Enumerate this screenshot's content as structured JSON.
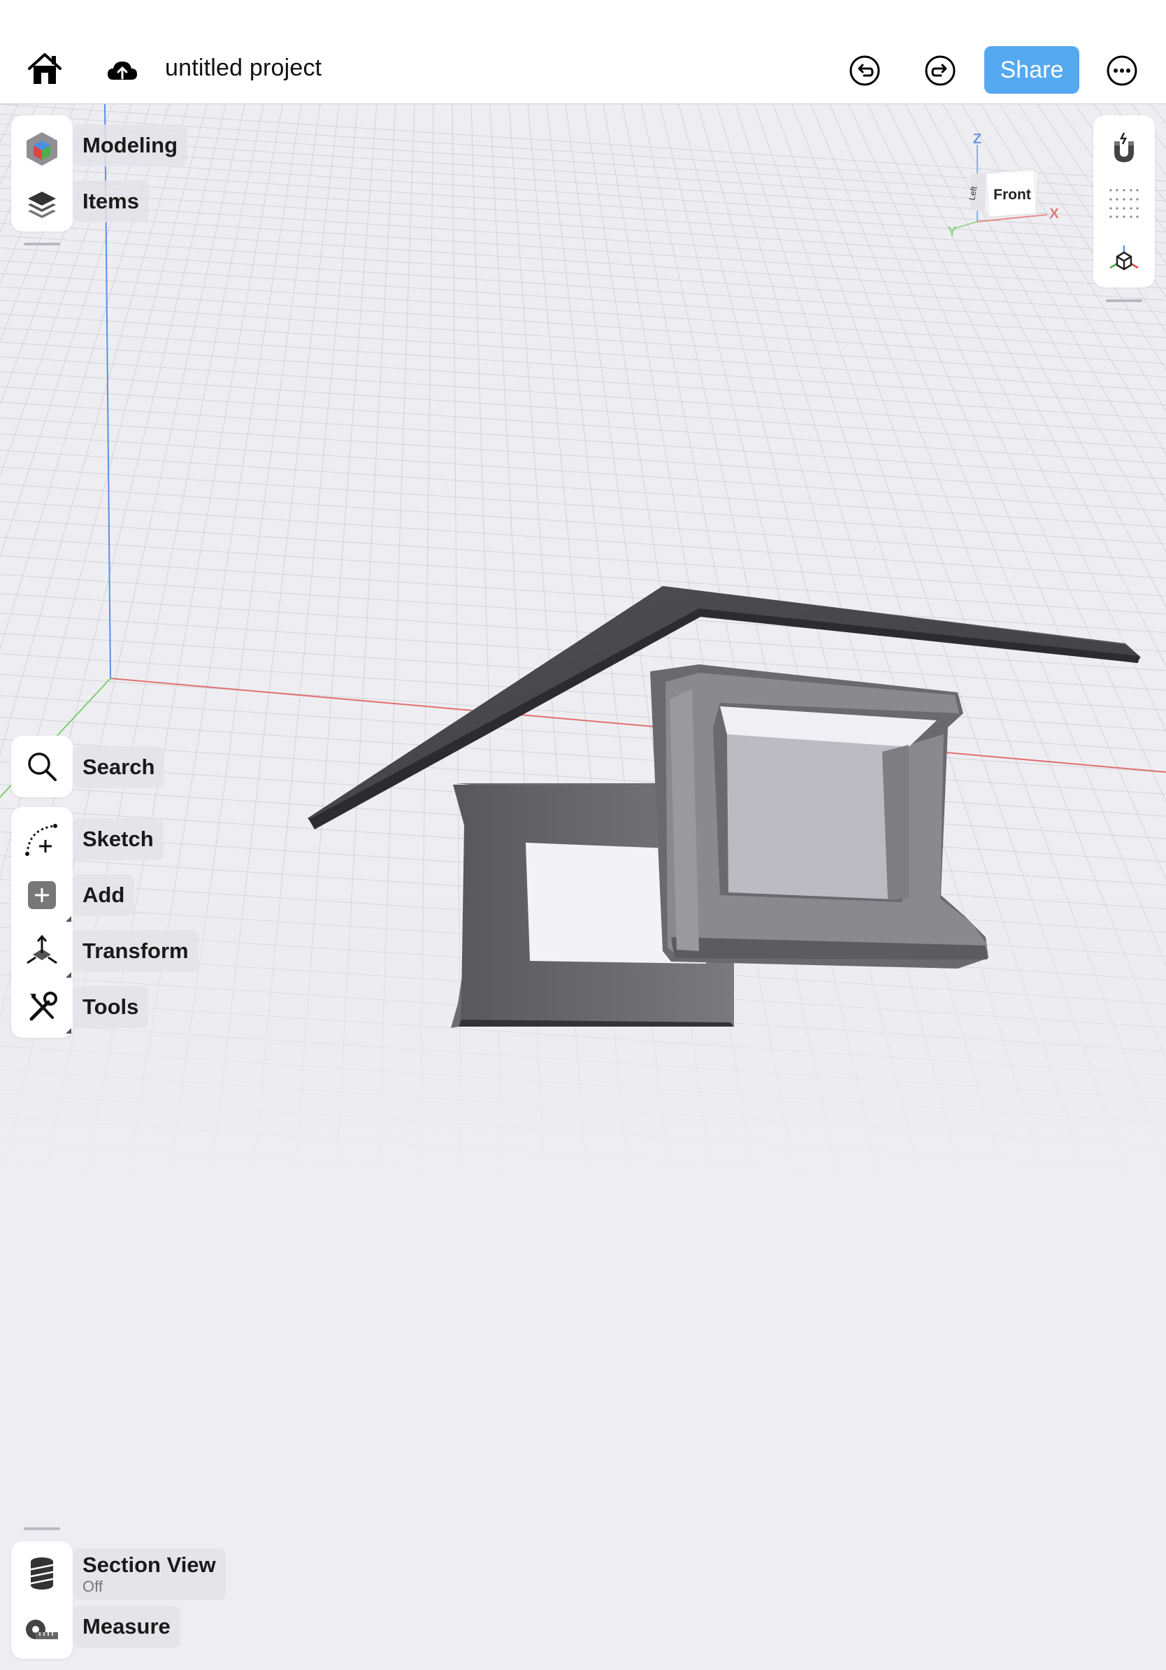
{
  "header": {
    "project_title": "untitled project",
    "share_label": "Share"
  },
  "left_top_panel": {
    "items": [
      {
        "label": "Modeling",
        "icon": "modeling-cube-icon"
      },
      {
        "label": "Items",
        "icon": "layers-icon"
      }
    ]
  },
  "left_mid_panel": {
    "search_label": "Search",
    "items": [
      {
        "label": "Sketch",
        "icon": "sketch-icon"
      },
      {
        "label": "Add",
        "icon": "add-icon"
      },
      {
        "label": "Transform",
        "icon": "transform-icon"
      },
      {
        "label": "Tools",
        "icon": "tools-icon"
      }
    ]
  },
  "left_bottom_panel": {
    "section_view_label": "Section View",
    "section_view_state": "Off",
    "measure_label": "Measure"
  },
  "view_cube": {
    "front_label": "Front",
    "left_label": "Left",
    "axis_x": "X",
    "axis_y": "Y",
    "axis_z": "Z"
  },
  "right_panel": {
    "icons": [
      "snap-magnet-icon",
      "grid-dots-icon",
      "view-cube-icon"
    ]
  },
  "colors": {
    "share_button": "#55a9f0",
    "axis_x": "#e07070",
    "axis_y": "#7fcf70",
    "axis_z": "#5b8ee8",
    "model": "#4a4a4e"
  }
}
